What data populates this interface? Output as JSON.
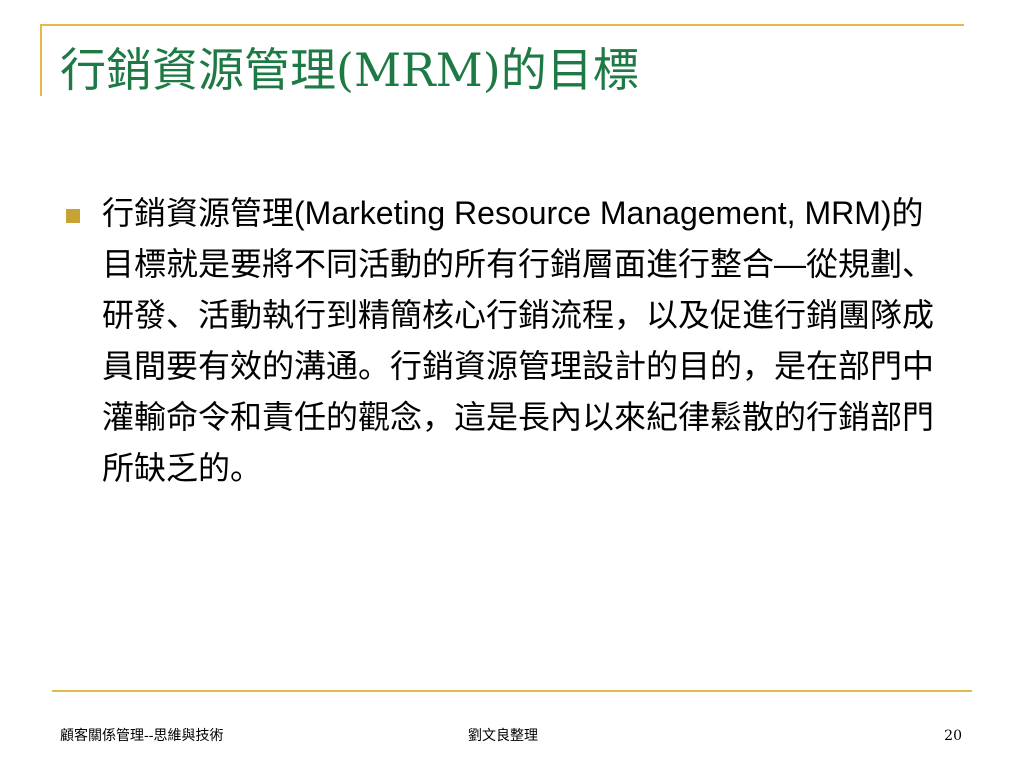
{
  "slide": {
    "title": "行銷資源管理(MRM)的目標",
    "bullets": [
      "行銷資源管理(Marketing Resource Management, MRM)的目標就是要將不同活動的所有行銷層面進行整合—從規劃、研發、活動執行到精簡核心行銷流程，以及促進行銷團隊成員間要有效的溝通。行銷資源管理設計的目的，是在部門中灌輸命令和責任的觀念，這是長內以來紀律鬆散的行銷部門所缺乏的。"
    ]
  },
  "footer": {
    "left": "顧客關係管理--思維與技術",
    "center": "劉文良整理",
    "page_number": "20"
  },
  "colors": {
    "title": "#1e7a45",
    "accent": "#e3b94d",
    "bullet": "#c8a233"
  }
}
